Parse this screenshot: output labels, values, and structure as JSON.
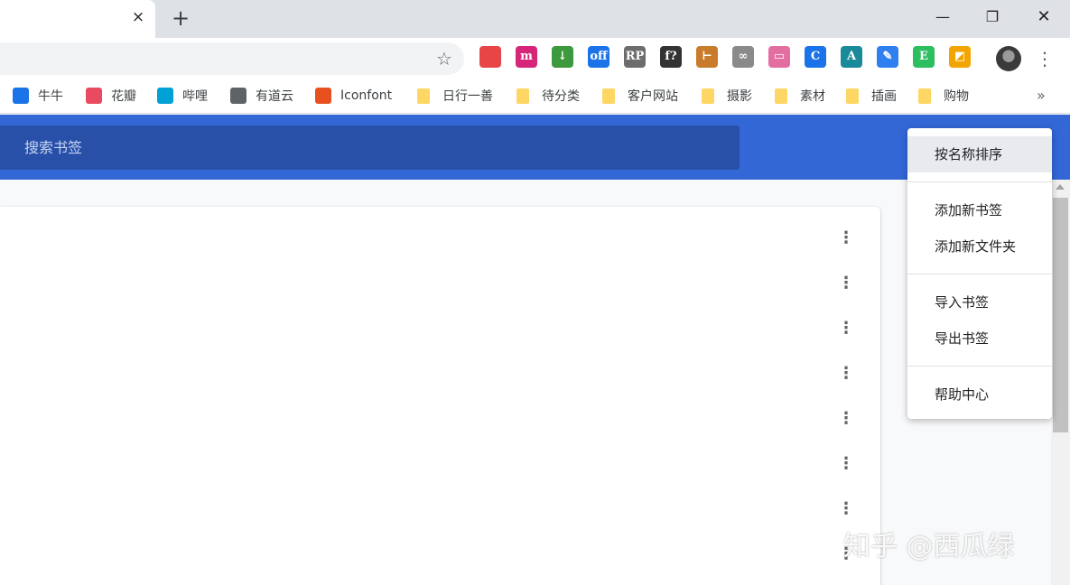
{
  "window": {
    "tab_close": "×",
    "new_tab": "+",
    "minimize": "—",
    "maximize": "❐",
    "close": "✕"
  },
  "toolbar": {
    "star": "☆",
    "extensions": [
      {
        "name": "ext-red",
        "text": "",
        "color": "#e84646"
      },
      {
        "name": "ext-m10",
        "text": "m",
        "color": "#d7267a"
      },
      {
        "name": "ext-down",
        "text": "↓",
        "color": "#3c9a3c"
      },
      {
        "name": "ext-off",
        "text": "off",
        "color": "#1a73e8"
      },
      {
        "name": "ext-rp",
        "text": "RP",
        "color": "#6d6d6d"
      },
      {
        "name": "ext-f",
        "text": "f?",
        "color": "#333333"
      },
      {
        "name": "ext-brush",
        "text": "⊢",
        "color": "#c87b2b"
      },
      {
        "name": "ext-link",
        "text": "∞",
        "color": "#8a8a8a"
      },
      {
        "name": "ext-tv",
        "text": "▭",
        "color": "#e26fa0"
      },
      {
        "name": "ext-blue-c",
        "text": "C",
        "color": "#1a73e8"
      },
      {
        "name": "ext-a",
        "text": "A",
        "color": "#1a8a9a"
      },
      {
        "name": "ext-pen",
        "text": "✎",
        "color": "#2f7ff0"
      },
      {
        "name": "ext-evernote",
        "text": "E",
        "color": "#2dbe60"
      },
      {
        "name": "ext-color",
        "text": "◩",
        "color": "#f2a500"
      }
    ],
    "menu": "⋮"
  },
  "bookmarks": [
    {
      "label": "牛牛",
      "icon_color": "#1a73e8",
      "type": "site"
    },
    {
      "label": "花瓣",
      "icon_color": "#e84a5f",
      "type": "site"
    },
    {
      "label": "哔哩",
      "icon_color": "#00a1d6",
      "type": "site"
    },
    {
      "label": "有道云",
      "icon_color": "#5f6368",
      "type": "site"
    },
    {
      "label": "Iconfont",
      "icon_color": "#e8501f",
      "type": "site"
    },
    {
      "label": "日行一善",
      "type": "folder"
    },
    {
      "label": "待分类",
      "type": "folder"
    },
    {
      "label": "客户网站",
      "type": "folder"
    },
    {
      "label": "摄影",
      "type": "folder"
    },
    {
      "label": "素材",
      "type": "folder"
    },
    {
      "label": "插画",
      "type": "folder"
    },
    {
      "label": "购物",
      "type": "folder"
    }
  ],
  "bookmarks_more": "»",
  "search": {
    "placeholder": "搜索书签",
    "icon": "⌕"
  },
  "row_menu_glyph": "⋮",
  "menu": {
    "items": [
      {
        "label": "按名称排序"
      },
      {
        "label": "添加新书签"
      },
      {
        "label": "添加新文件夹"
      },
      {
        "label": "导入书签"
      },
      {
        "label": "导出书签"
      },
      {
        "label": "帮助中心"
      }
    ]
  },
  "watermark": "知乎 @西瓜绿"
}
